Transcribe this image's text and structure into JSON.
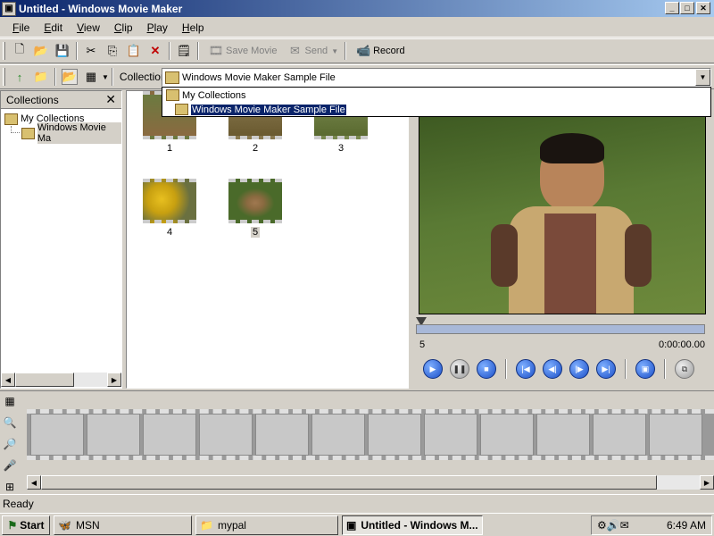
{
  "window": {
    "title": "Untitled - Windows Movie Maker"
  },
  "menu": [
    "File",
    "Edit",
    "View",
    "Clip",
    "Play",
    "Help"
  ],
  "toolbar": {
    "save_movie": "Save Movie",
    "send": "Send",
    "record": "Record",
    "collection_label": "Collection"
  },
  "collection_combo": {
    "value": "Windows Movie Maker Sample File"
  },
  "dropdown": {
    "items": [
      "My Collections",
      "Windows Movie Maker Sample File"
    ],
    "selected_index": 1
  },
  "collections_pane": {
    "title": "Collections",
    "tree": [
      {
        "label": "My Collections"
      },
      {
        "label": "Windows Movie Ma"
      }
    ]
  },
  "clips": [
    {
      "number": "1"
    },
    {
      "number": "2"
    },
    {
      "number": "3"
    },
    {
      "number": "4"
    },
    {
      "number": "5",
      "selected": true
    }
  ],
  "monitor": {
    "clip_name": "5",
    "time": "0:00:00.00"
  },
  "status": {
    "text": "Ready"
  },
  "taskbar": {
    "start": "Start",
    "tasks": [
      "MSN",
      "mypal",
      "Untitled - Windows M..."
    ],
    "clock": "6:49 AM"
  }
}
